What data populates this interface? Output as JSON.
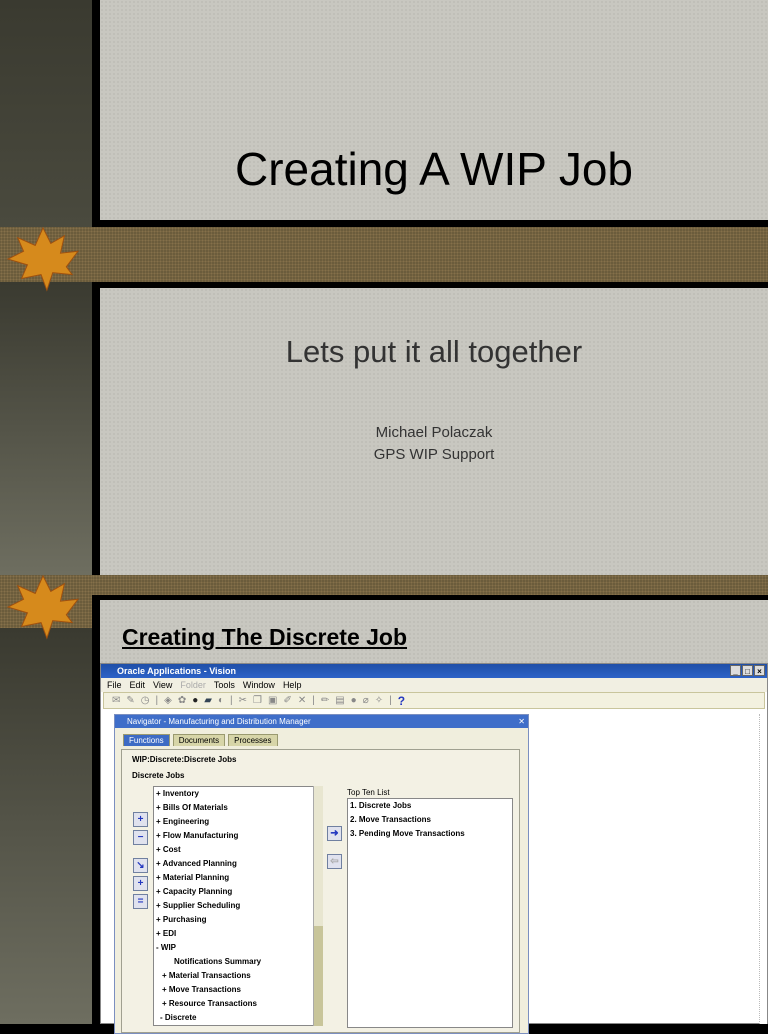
{
  "slide1": {
    "title": "Creating A WIP Job"
  },
  "slide2": {
    "subtitle": "Lets put it all together",
    "author": "Michael Polaczak",
    "team": "GPS WIP Support"
  },
  "slide3": {
    "heading": "Creating The Discrete Job"
  },
  "app": {
    "title": "Oracle Applications - Vision",
    "menu": [
      "File",
      "Edit",
      "View",
      "Folder",
      "Tools",
      "Window",
      "Help"
    ],
    "help_icon": "?",
    "navigator": {
      "title": "Navigator - Manufacturing and Distribution Manager",
      "tabs": [
        "Functions",
        "Documents",
        "Processes"
      ],
      "path": "WIP:Discrete:Discrete Jobs",
      "selected": "Discrete Jobs",
      "tree": [
        "+ Inventory",
        "+ Bills Of Materials",
        "+ Engineering",
        "+ Flow Manufacturing",
        "+ Cost",
        "+ Advanced Planning",
        "+ Material Planning",
        "+ Capacity Planning",
        "+ Supplier Scheduling",
        "+ Purchasing",
        "+ EDI",
        "- WIP",
        "Notifications Summary",
        "+ Material Transactions",
        "+ Move Transactions",
        "+ Resource Transactions",
        "- Discrete"
      ],
      "top_ten_label": "Top Ten List",
      "top_ten": [
        "1. Discrete Jobs",
        "2. Move Transactions",
        "3. Pending Move Transactions"
      ]
    }
  },
  "colors": {
    "panel": "#c8c7c0",
    "band": "#6b5c3c",
    "titlebar": "#2c62c8"
  }
}
